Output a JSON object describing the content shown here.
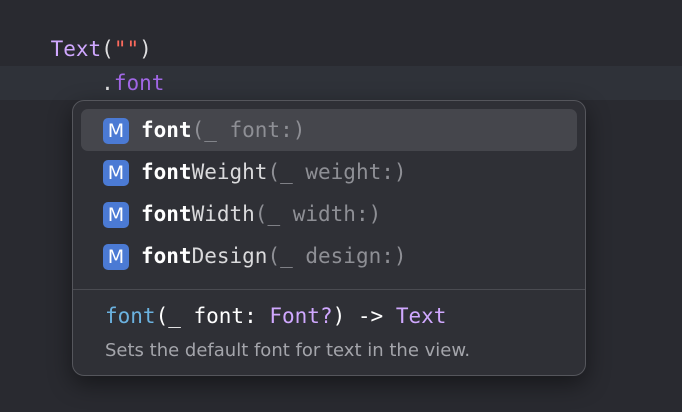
{
  "code": {
    "line1": {
      "type": "Text",
      "open": "(",
      "string": "\"\"",
      "close": ")"
    },
    "line2": {
      "dot": ".",
      "method": "font"
    }
  },
  "completion": {
    "badge": "M",
    "items": [
      {
        "match": "font",
        "rest": "",
        "signature": "(_ font:)",
        "selected": true
      },
      {
        "match": "font",
        "rest": "Weight",
        "signature": "(_ weight:)",
        "selected": false
      },
      {
        "match": "font",
        "rest": "Width",
        "signature": "(_ width:)",
        "selected": false
      },
      {
        "match": "font",
        "rest": "Design",
        "signature": "(_ design:)",
        "selected": false
      }
    ],
    "declaration": {
      "name": "font",
      "params_open": "(_ font: ",
      "param_type": "Font?",
      "params_close": ") -> ",
      "return_type": "Text"
    },
    "description": "Sets the default font for text in the view."
  },
  "colors": {
    "background": "#292a30",
    "current_line": "#2f3239",
    "popup_background": "#2f3036",
    "selected_row": "#45464c",
    "method_badge": "#4b7ad4",
    "keyword_type": "#d0a8ff",
    "method_name": "#a167e6",
    "string": "#fc6a5d"
  }
}
